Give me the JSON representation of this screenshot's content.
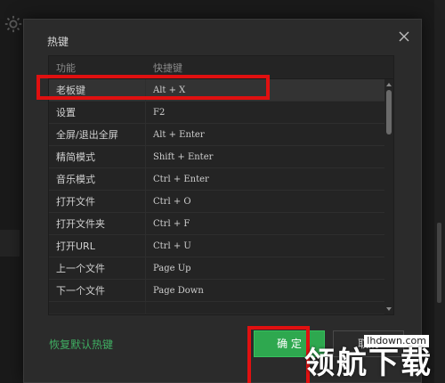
{
  "dialog": {
    "title": "热键",
    "close_icon": "close-icon"
  },
  "table": {
    "headers": {
      "function": "功能",
      "shortcut": "快捷键"
    },
    "rows": [
      {
        "function": "老板键",
        "shortcut": "Alt + X"
      },
      {
        "function": "设置",
        "shortcut": "F2"
      },
      {
        "function": "全屏/退出全屏",
        "shortcut": "Alt + Enter"
      },
      {
        "function": "精简模式",
        "shortcut": "Shift + Enter"
      },
      {
        "function": "音乐模式",
        "shortcut": "Ctrl + Enter"
      },
      {
        "function": "打开文件",
        "shortcut": "Ctrl + O"
      },
      {
        "function": "打开文件夹",
        "shortcut": "Ctrl + F"
      },
      {
        "function": "打开URL",
        "shortcut": "Ctrl + U"
      },
      {
        "function": "上一个文件",
        "shortcut": "Page Up"
      },
      {
        "function": "下一个文件",
        "shortcut": "Page Down"
      }
    ]
  },
  "footer": {
    "reset_label": "恢复默认热键",
    "ok_label": "确 定",
    "cancel_label": "取消"
  },
  "watermark": {
    "url": "lhdown.com",
    "text": "领航下载"
  },
  "colors": {
    "accent": "#2ea84f",
    "link": "#3fae62",
    "annotation": "#e01010",
    "dialog_bg": "#2b2b2b"
  }
}
